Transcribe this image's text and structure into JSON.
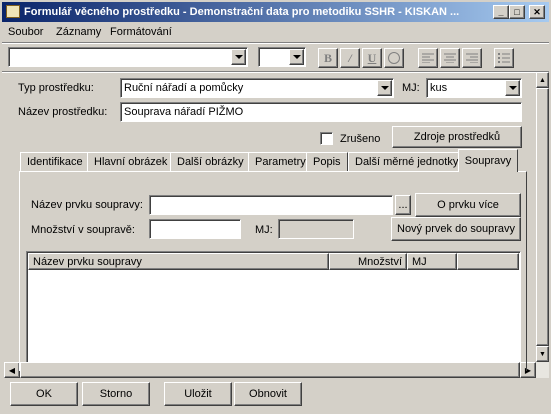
{
  "window": {
    "title": "Formulář věcného prostředku - Demonstrační data pro metodiku SSHR - KISKAN ..."
  },
  "menu": [
    "Soubor",
    "Záznamy",
    "Formátování"
  ],
  "form": {
    "type_label": "Typ prostředku:",
    "type_value": "Ruční nářadí a pomůcky",
    "unit_label": "MJ:",
    "unit_value": "kus",
    "name_label": "Název prostředku:",
    "name_value": "Souprava nářadí PIŽMO",
    "cancelled_label": "Zrušeno",
    "sources_button": "Zdroje prostředků"
  },
  "tabs": [
    "Identifikace",
    "Hlavní obrázek",
    "Další obrázky",
    "Parametry",
    "Popis",
    "Další měrné jednotky",
    "Soupravy"
  ],
  "active_tab": "Soupravy",
  "kit": {
    "item_name_label": "Název prvku soupravy:",
    "item_name_value": "",
    "browse_button": "...",
    "info_button": "O prvku více",
    "quantity_label": "Množství v soupravě:",
    "quantity_value": "",
    "unit_label": "MJ:",
    "unit_value": "",
    "new_item_button": "Nový prvek do soupravy",
    "columns": [
      "Název prvku soupravy",
      "Množství",
      "MJ"
    ]
  },
  "bottom_buttons": {
    "ok": "OK",
    "cancel": "Storno",
    "save": "Uložit",
    "refresh": "Obnovit"
  }
}
